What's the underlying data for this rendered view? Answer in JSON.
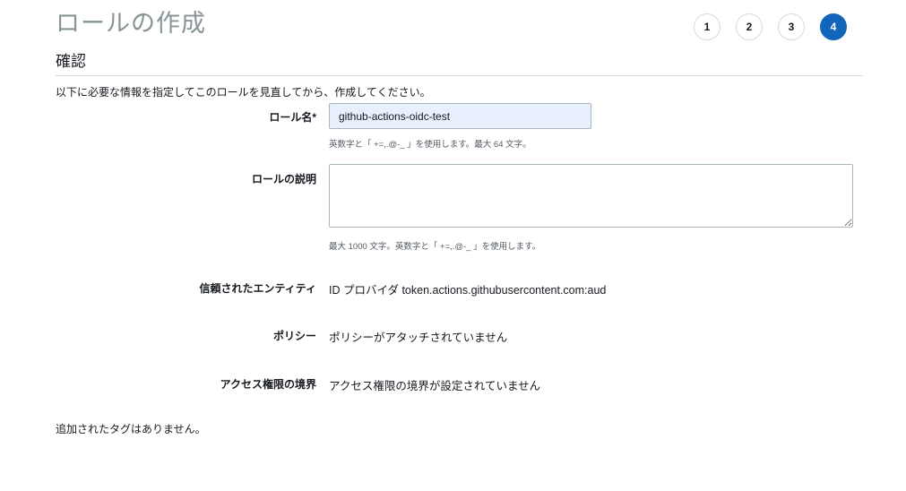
{
  "header": {
    "title": "ロールの作成",
    "steps": [
      "1",
      "2",
      "3",
      "4"
    ],
    "active_step": "4"
  },
  "section": {
    "title": "確認",
    "intro": "以下に必要な情報を指定してこのロールを見直してから、作成してください。"
  },
  "form": {
    "role_name_label": "ロール名*",
    "role_name_value": "github-actions-oidc-test",
    "role_name_hint": "英数字と「 +=,.@-_ 」を使用します。最大 64 文字。",
    "description_label": "ロールの説明",
    "description_value": "",
    "description_hint": "最大 1000 文字。英数字と「 +=,.@-_ 」を使用します。",
    "trusted_entity_label": "信頼されたエンティティ",
    "trusted_entity_value": "ID プロバイダ token.actions.githubusercontent.com:aud",
    "policy_label": "ポリシー",
    "policy_value": "ポリシーがアタッチされていません",
    "boundary_label": "アクセス権限の境界",
    "boundary_value": "アクセス権限の境界が設定されていません"
  },
  "footer": {
    "tags_text": "追加されたタグはありません。"
  },
  "colors": {
    "accent": "#1166bb",
    "title_gray": "#879596",
    "input_fill": "#e8f0fe"
  }
}
